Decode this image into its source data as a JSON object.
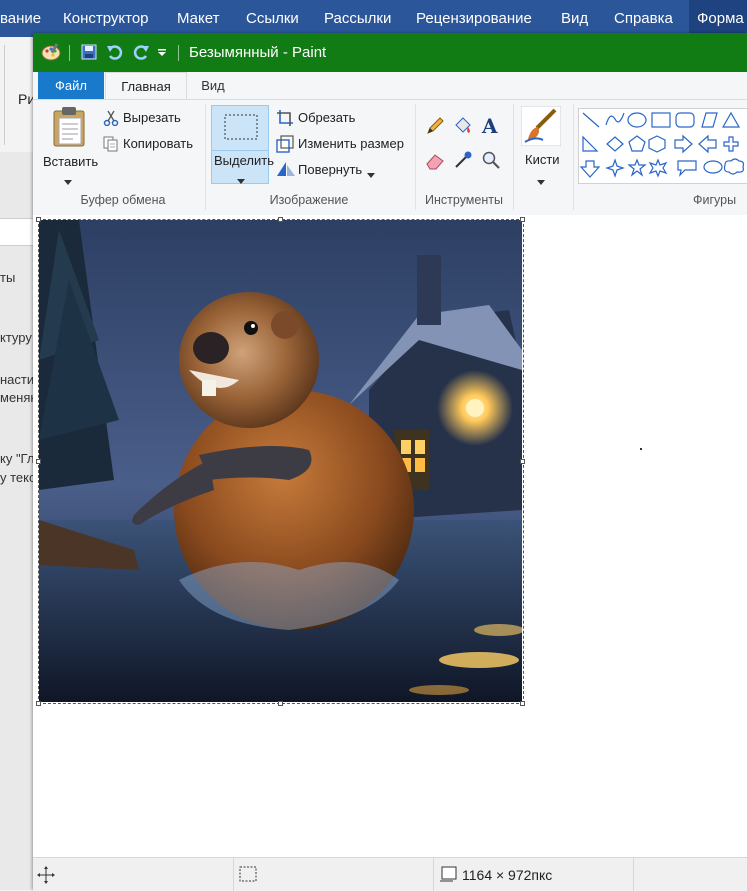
{
  "word": {
    "tabs": [
      "вание",
      "Конструктор",
      "Макет",
      "Ссылки",
      "Рассылки",
      "Рецензирование",
      "Вид",
      "Справка",
      "Форма"
    ],
    "ribbon_fragment": "Ри",
    "doc_lines": [
      "ты",
      "ктуру",
      "насти",
      "меняю",
      "ку \"Гл",
      "у текс"
    ]
  },
  "paint": {
    "title": "Безымянный - Paint",
    "tabs": {
      "file": "Файл",
      "home": "Главная",
      "view": "Вид"
    },
    "clipboard": {
      "paste": "Вставить",
      "cut": "Вырезать",
      "copy": "Копировать",
      "label": "Буфер обмена"
    },
    "image": {
      "select": "Выделить",
      "crop": "Обрезать",
      "resize": "Изменить размер",
      "rotate": "Повернуть",
      "label": "Изображение"
    },
    "tools": {
      "label": "Инструменты"
    },
    "brushes": {
      "label": "Кисти"
    },
    "shapes": {
      "label": "Фигуры"
    },
    "status": {
      "image_size": "1164 × 972пкс"
    }
  },
  "colors": {
    "word_blue": "#2b579a",
    "paint_title_green": "#127c14",
    "file_tab_blue": "#1979ca",
    "selection_highlight": "#cce4f7"
  },
  "icons": [
    "paint-app-icon",
    "save-icon",
    "undo-icon",
    "redo-icon",
    "quick-access-dropdown-icon",
    "paste-icon",
    "scissors-icon",
    "copy-icon",
    "select-icon",
    "crop-icon",
    "resize-icon",
    "rotate-icon",
    "pencil-icon",
    "fill-icon",
    "text-icon",
    "eraser-icon",
    "color-picker-icon",
    "magnifier-icon",
    "brush-icon",
    "move-cursor-icon",
    "selection-size-icon",
    "image-size-icon"
  ]
}
